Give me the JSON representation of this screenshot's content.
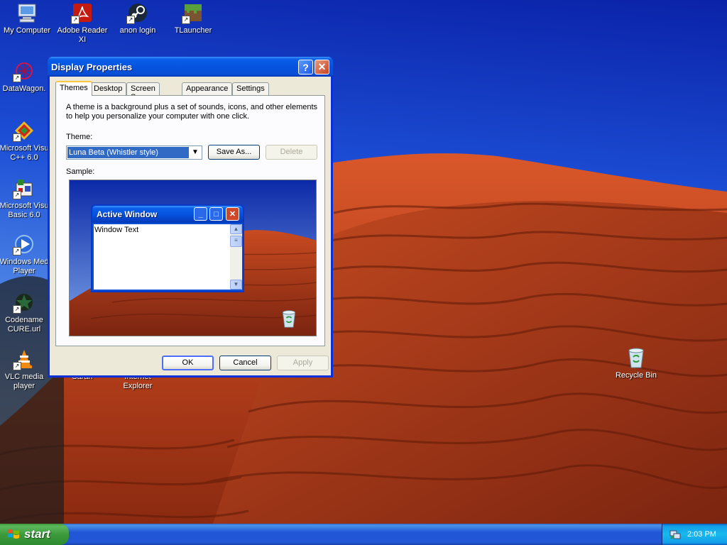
{
  "desktop": {
    "icons": [
      {
        "label": "My Computer"
      },
      {
        "label": "Adobe Reader XI"
      },
      {
        "label": "anon login"
      },
      {
        "label": "TLauncher"
      },
      {
        "label": "DataWagon."
      },
      {
        "label": "Microsoft Visu C++ 6.0"
      },
      {
        "label": "Microsoft Visu Basic 6.0"
      },
      {
        "label": "Windows Med Player"
      },
      {
        "label": "Codename CURE.url"
      },
      {
        "label": "VLC media player"
      },
      {
        "label": "Recycle Bin"
      }
    ],
    "partial_labels": [
      "Sarah",
      "Internet Explorer"
    ]
  },
  "dialog": {
    "title": "Display Properties",
    "help_glyph": "?",
    "close_glyph": "✕",
    "tabs": [
      {
        "label": "Themes"
      },
      {
        "label": "Desktop"
      },
      {
        "label": "Screen Saver"
      },
      {
        "label": "Appearance"
      },
      {
        "label": "Settings"
      }
    ],
    "description": "A theme is a background plus a set of sounds, icons, and other elements to help you personalize your computer with one click.",
    "theme_label": "Theme:",
    "theme_value": "Luna Beta (Whistler style)",
    "save_as_label": "Save As...",
    "delete_label": "Delete",
    "sample_label": "Sample:",
    "sample_window": {
      "title": "Active Window",
      "body_text": "Window Text"
    },
    "ok_label": "OK",
    "cancel_label": "Cancel",
    "apply_label": "Apply"
  },
  "taskbar": {
    "start_label": "start",
    "clock": "2:03 PM"
  }
}
